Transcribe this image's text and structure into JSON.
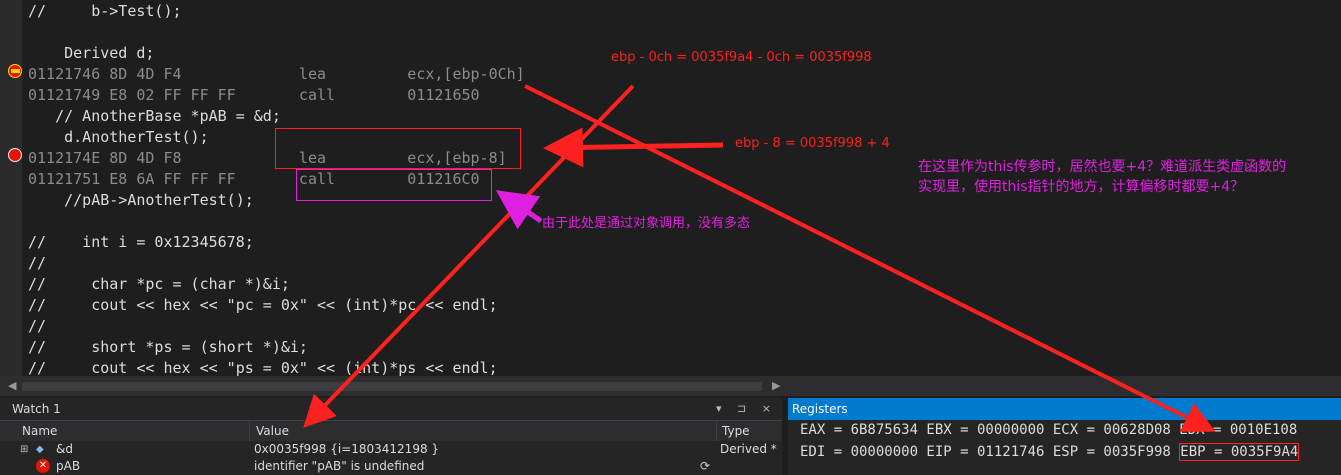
{
  "code_lines": [
    {
      "text": "//     b->Test();",
      "kind": "src"
    },
    {
      "text": "",
      "kind": "src"
    },
    {
      "text": "    Derived d;",
      "kind": "src"
    },
    {
      "text": "01121746 8D 4D F4             lea         ecx,[ebp-0Ch]",
      "kind": "asm"
    },
    {
      "text": "01121749 E8 02 FF FF FF       call        01121650",
      "kind": "asm"
    },
    {
      "text": "   // AnotherBase *pAB = &d;",
      "kind": "src"
    },
    {
      "text": "    d.AnotherTest();",
      "kind": "src"
    },
    {
      "text": "0112174E 8D 4D F8             lea         ecx,[ebp-8]",
      "kind": "asm"
    },
    {
      "text": "01121751 E8 6A FF FF FF       call        011216C0",
      "kind": "asm"
    },
    {
      "text": "    //pAB->AnotherTest();",
      "kind": "src"
    },
    {
      "text": "",
      "kind": "src"
    },
    {
      "text": "//    int i = 0x12345678;",
      "kind": "src"
    },
    {
      "text": "//",
      "kind": "src"
    },
    {
      "text": "//     char *pc = (char *)&i;",
      "kind": "src"
    },
    {
      "text": "//     cout << hex << \"pc = 0x\" << (int)*pc << endl;",
      "kind": "src"
    },
    {
      "text": "//",
      "kind": "src"
    },
    {
      "text": "//     short *ps = (short *)&i;",
      "kind": "src"
    },
    {
      "text": "//     cout << hex << \"ps = 0x\" << (int)*ps << endl;",
      "kind": "src"
    }
  ],
  "annotations": {
    "ebp_0ch": "ebp - 0ch = 0035f9a4 - 0ch = 0035f998",
    "ebp_8": "ebp - 8 = 0035f998 + 4",
    "no_polymorphism": "由于此处是通过对象调用，没有多态",
    "question_line1": "在这里作为this传参时，居然也要+4？难道派生类虚函数的",
    "question_line2": "实现里，使用this指针的地方，计算偏移时都要+4？"
  },
  "watch": {
    "title": "Watch 1",
    "columns": [
      "Name",
      "Value",
      "Type"
    ],
    "rows": [
      {
        "name": "&d",
        "value": "0x0035f998 {i=1803412198 }",
        "type": "Derived *"
      },
      {
        "name": "pAB",
        "value": "identifier \"pAB\" is undefined",
        "type": ""
      }
    ],
    "controls": "▾ ⊐ ×"
  },
  "registers": {
    "title": "Registers",
    "line1": "EAX = 6B875634 EBX = 00000000 ECX = 00628D08 EDX = 0010E108",
    "line2_prefix": "EDI = 00000000 EIP = 01121746 ESP = 0035F998 ",
    "line2_ebp": "EBP = 0035F9A4"
  },
  "colors": {
    "annotation_red": "#ff2020",
    "annotation_magenta": "#e020e0",
    "register_accent": "#007acc"
  },
  "icons": [
    "breakpoint-icon",
    "instruction-pointer-icon",
    "expand-icon",
    "pointer-icon",
    "error-icon",
    "refresh-icon"
  ]
}
